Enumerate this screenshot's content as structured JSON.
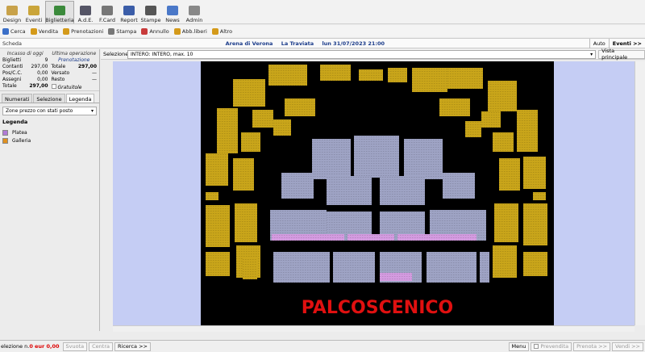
{
  "modules": [
    {
      "label": "Design",
      "icon": "design-icon",
      "color": "#c8a24a"
    },
    {
      "label": "Eventi",
      "icon": "events-icon",
      "color": "#caa53a"
    },
    {
      "label": "Biglietteria",
      "icon": "ticket-icon",
      "color": "#3b8a3b",
      "active": true
    },
    {
      "label": "A.d.E.",
      "icon": "ade-icon",
      "color": "#556"
    },
    {
      "label": "F.Card",
      "icon": "card-icon",
      "color": "#777"
    },
    {
      "label": "Report",
      "icon": "report-icon",
      "color": "#3b5da8"
    },
    {
      "label": "Stampe",
      "icon": "printer-icon",
      "color": "#555"
    },
    {
      "label": "News",
      "icon": "news-icon",
      "color": "#4a78c8"
    },
    {
      "label": "Admin",
      "icon": "admin-icon",
      "color": "#888"
    }
  ],
  "actions": [
    {
      "label": "Cerca",
      "icon": "search-icon",
      "color": "#3b6fc8"
    },
    {
      "label": "Vendita",
      "icon": "sell-icon",
      "color": "#d49a1a"
    },
    {
      "label": "Prenotazioni",
      "icon": "booking-icon",
      "color": "#d49a1a"
    },
    {
      "label": "Stampa",
      "icon": "print-icon",
      "color": "#777"
    },
    {
      "label": "Annullo",
      "icon": "cancel-icon",
      "color": "#c83b3b"
    },
    {
      "label": "Abb.liberi",
      "icon": "subscription-icon",
      "color": "#d49a1a"
    },
    {
      "label": "Altro",
      "icon": "more-icon",
      "color": "#d49a1a"
    }
  ],
  "scheda": {
    "label": "Scheda",
    "venue": "Arena di Verona",
    "show": "La Traviata",
    "datetime": "lun 31/07/2023 21:00",
    "auto_label": "Auto",
    "events_label": "Eventi >>"
  },
  "stats": {
    "today_header": "Incasso di oggi",
    "last_header": "Ultima operazione",
    "last_type": "Prenotazione",
    "today": [
      {
        "k": "Biglietti",
        "v": "9"
      },
      {
        "k": "Contanti",
        "v": "297,00"
      },
      {
        "k": "Pos/C.C.",
        "v": "0,00"
      },
      {
        "k": "Assegni",
        "v": "0,00"
      },
      {
        "k": "Totale",
        "v": "297,00"
      }
    ],
    "last": [
      {
        "k": "Totale",
        "v": "297,00"
      },
      {
        "k": "Versato",
        "v": "—"
      },
      {
        "k": "Resto",
        "v": "—"
      }
    ],
    "gratuitous_label": "Gratuitole"
  },
  "tabs": [
    "Numerati",
    "Selezione",
    "Legenda"
  ],
  "zone_combo": "Zone prezzo con stati posto",
  "legend": {
    "title": "Legenda",
    "items": [
      {
        "label": "Platea",
        "color": "#b07ad6"
      },
      {
        "label": "Galleria",
        "color": "#e0911f"
      }
    ]
  },
  "selection": {
    "label": "Selezione",
    "value": "INTERO: INTERO, max. 10",
    "view_label": "Vista principale"
  },
  "stage_label": "PALCOSCENICO",
  "colors": {
    "stage_bg": "#000000",
    "map_bg": "#c5cdf4",
    "galleria_seat": "#c9a51a",
    "platea_seat": "#9ea3c4",
    "selected_seat": "#d49be0",
    "stage_text": "#e01010"
  },
  "bottom": {
    "selection_prefix": "elezione n.",
    "selection_count": "0",
    "selection_eur": "eur 0,00",
    "svuota": "Svuota",
    "centra": "Centra",
    "ricerca": "Ricerca >>",
    "menu": "Menu",
    "prevendita": "Prevendita",
    "prenota": "Prenota >>",
    "vendi": "Vendi >>"
  }
}
